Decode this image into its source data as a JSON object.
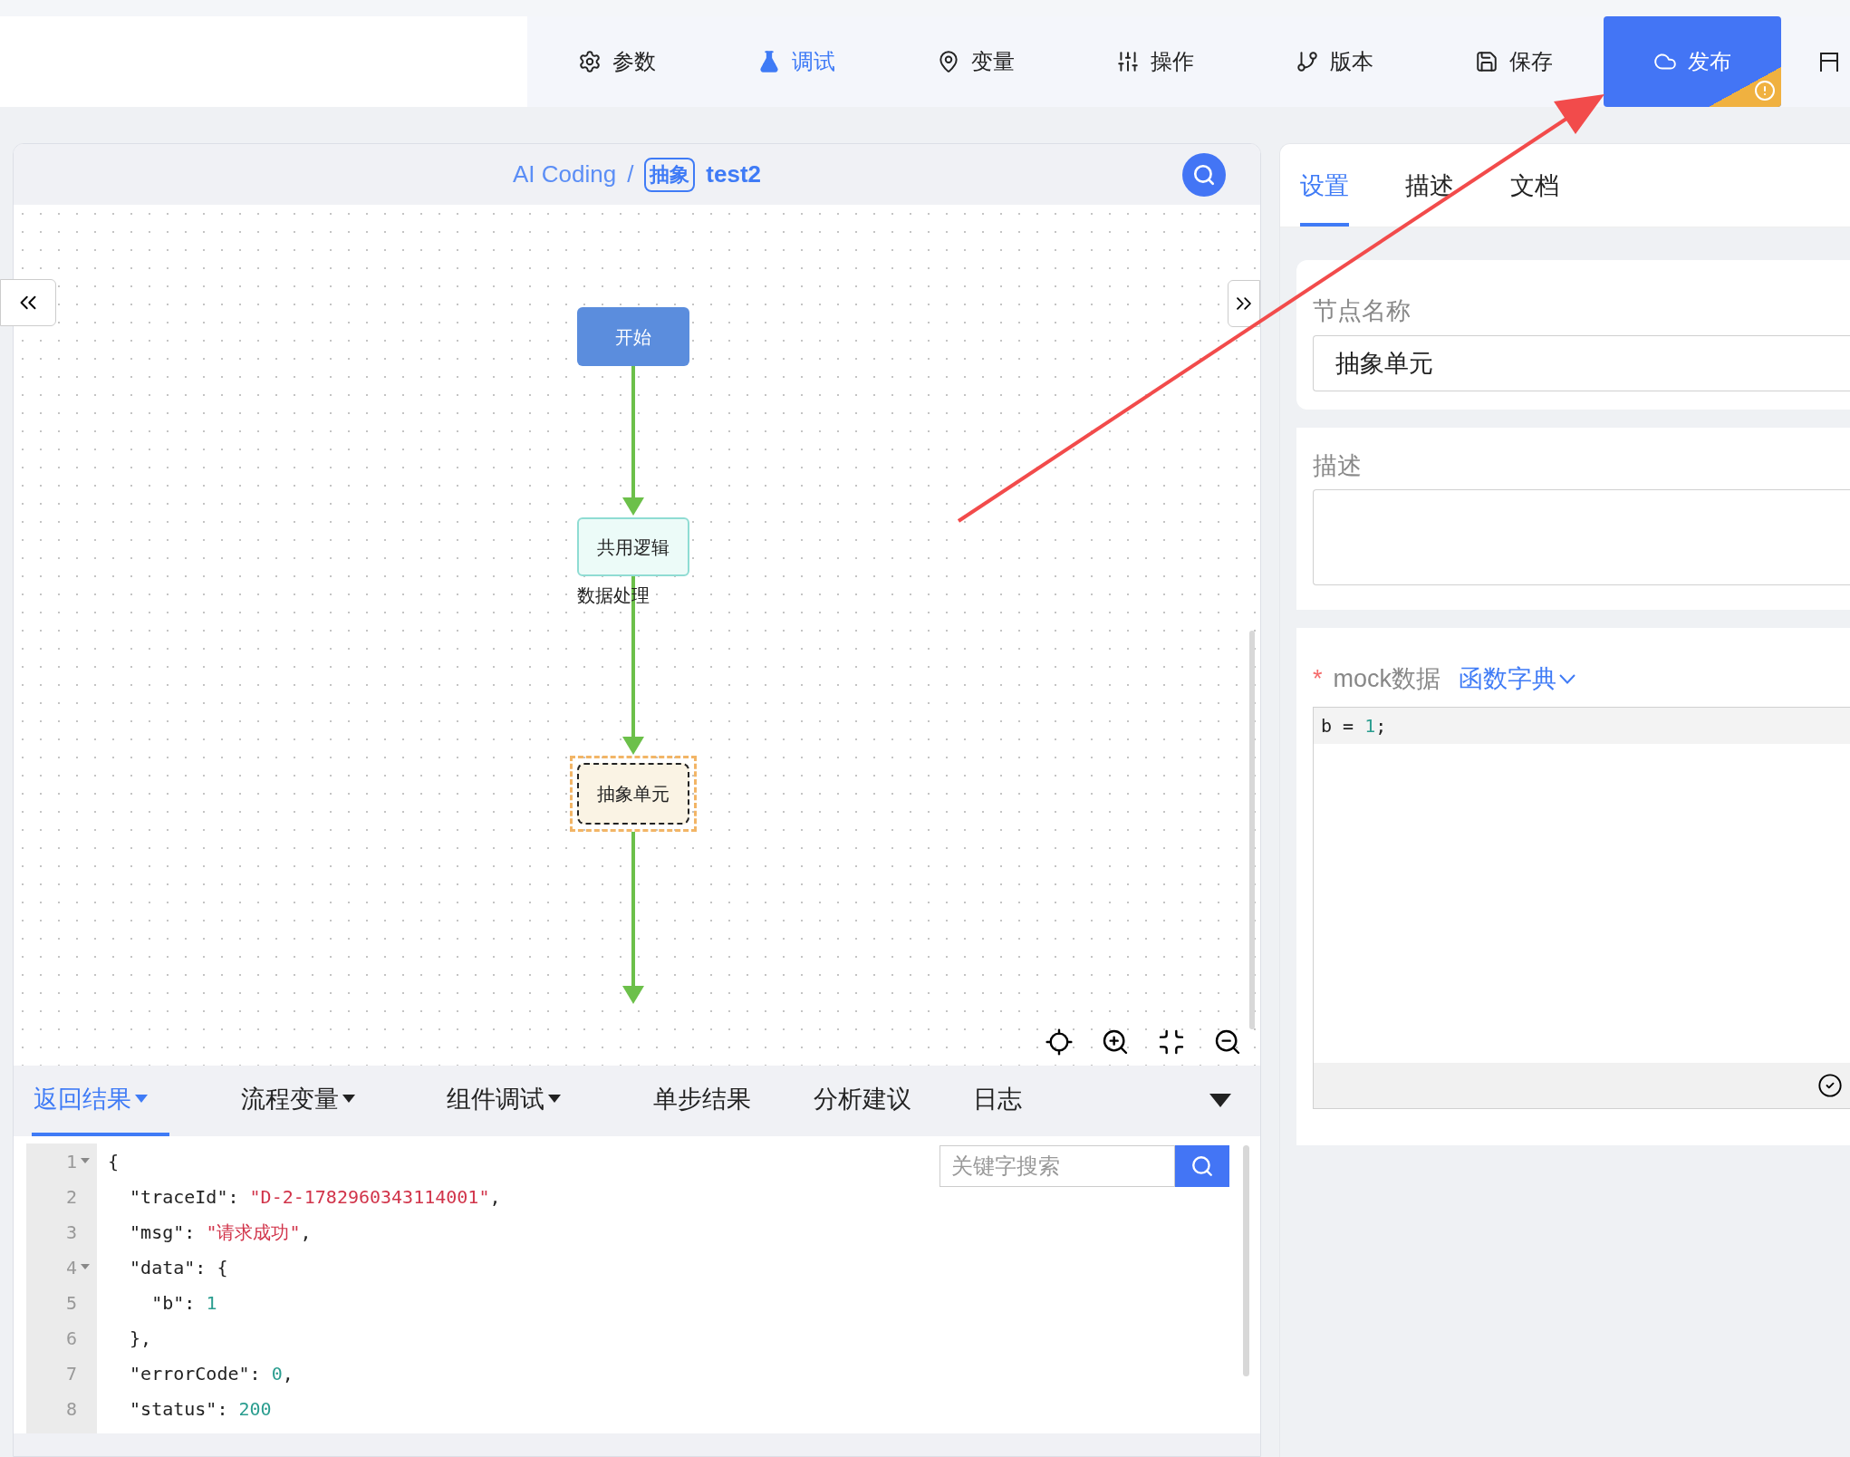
{
  "toolbar": {
    "items": [
      {
        "label": "参数",
        "selected": false
      },
      {
        "label": "调试",
        "selected": true
      },
      {
        "label": "变量",
        "selected": false
      },
      {
        "label": "操作",
        "selected": false
      },
      {
        "label": "版本",
        "selected": false
      },
      {
        "label": "保存",
        "selected": false
      }
    ],
    "publish_button": {
      "label": "发布",
      "warning": true
    }
  },
  "canvas": {
    "breadcrumb": {
      "root": "AI Coding",
      "separator": "/",
      "tag": "抽象",
      "name": "test2"
    },
    "nodes": [
      {
        "kind": "start",
        "label": "开始",
        "selected": false
      },
      {
        "kind": "logic",
        "label": "共用逻辑",
        "caption": "数据处理",
        "selected": false
      },
      {
        "kind": "abstract",
        "label": "抽象单元",
        "selected": true
      }
    ]
  },
  "bottom_panel": {
    "tabs": [
      {
        "label": "返回结果",
        "dropdown": true,
        "selected": true
      },
      {
        "label": "流程变量",
        "dropdown": true,
        "selected": false
      },
      {
        "label": "组件调试",
        "dropdown": true,
        "selected": false
      },
      {
        "label": "单步结果",
        "dropdown": false,
        "selected": false
      },
      {
        "label": "分析建议",
        "dropdown": false,
        "selected": false
      },
      {
        "label": "日志",
        "dropdown": false,
        "selected": false
      }
    ],
    "search": {
      "placeholder": "关键字搜索"
    },
    "code_lines": [
      {
        "number": "1",
        "foldable": true,
        "parts": [
          {
            "kind": "punct",
            "text": "{"
          }
        ]
      },
      {
        "number": "2",
        "foldable": false,
        "parts": [
          {
            "kind": "key",
            "text": "  \"traceId\": "
          },
          {
            "kind": "string",
            "text": "\"D-2-1782960343114001\""
          },
          {
            "kind": "punct",
            "text": ","
          }
        ]
      },
      {
        "number": "3",
        "foldable": false,
        "parts": [
          {
            "kind": "key",
            "text": "  \"msg\": "
          },
          {
            "kind": "string",
            "text": "\"请求成功\""
          },
          {
            "kind": "punct",
            "text": ","
          }
        ]
      },
      {
        "number": "4",
        "foldable": true,
        "parts": [
          {
            "kind": "key",
            "text": "  \"data\": "
          },
          {
            "kind": "punct",
            "text": "{"
          }
        ]
      },
      {
        "number": "5",
        "foldable": false,
        "parts": [
          {
            "kind": "key",
            "text": "    \"b\": "
          },
          {
            "kind": "number",
            "text": "1"
          }
        ]
      },
      {
        "number": "6",
        "foldable": false,
        "parts": [
          {
            "kind": "punct",
            "text": "  },"
          }
        ]
      },
      {
        "number": "7",
        "foldable": false,
        "parts": [
          {
            "kind": "key",
            "text": "  \"errorCode\": "
          },
          {
            "kind": "number",
            "text": "0"
          },
          {
            "kind": "punct",
            "text": ","
          }
        ]
      },
      {
        "number": "8",
        "foldable": false,
        "parts": [
          {
            "kind": "key",
            "text": "  \"status\": "
          },
          {
            "kind": "number",
            "text": "200"
          }
        ]
      }
    ]
  },
  "side_panel": {
    "tabs": [
      {
        "label": "设置",
        "selected": true
      },
      {
        "label": "描述",
        "selected": false
      },
      {
        "label": "文档",
        "selected": false
      }
    ],
    "node_name": {
      "label": "节点名称",
      "value": "抽象单元"
    },
    "description": {
      "label": "描述"
    },
    "mock": {
      "required_mark": "*",
      "label": "mock数据",
      "link": "函数字典",
      "code_parts": [
        {
          "kind": "key",
          "text": "b"
        },
        {
          "kind": "punct",
          "text": " = "
        },
        {
          "kind": "number",
          "text": "1"
        },
        {
          "kind": "punct",
          "text": ";"
        }
      ]
    }
  }
}
